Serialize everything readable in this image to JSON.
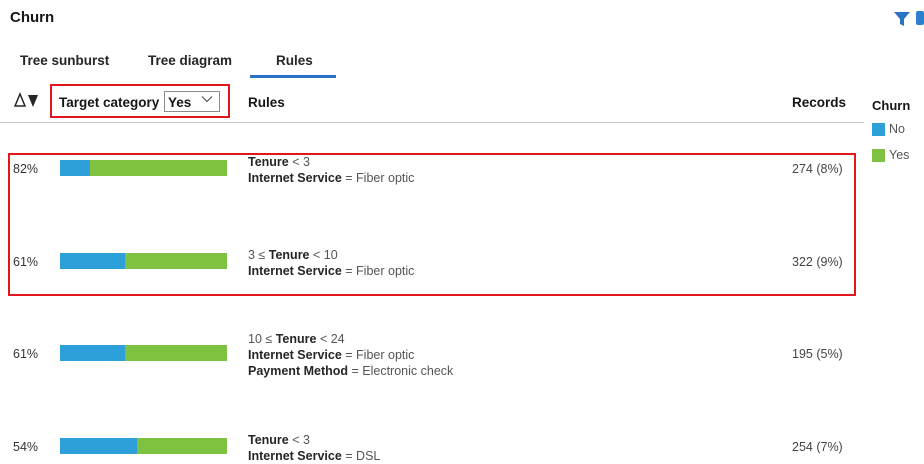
{
  "title": "Churn",
  "tabs": [
    {
      "label": "Tree sunburst",
      "active": false
    },
    {
      "label": "Tree diagram",
      "active": false
    },
    {
      "label": "Rules",
      "active": true
    }
  ],
  "header": {
    "sort_icon": "sort-triangles-icon",
    "target_label": "Target category",
    "target_value": "Yes",
    "rules_label": "Rules",
    "records_label": "Records"
  },
  "legend": {
    "title": "Churn",
    "items": [
      {
        "label": "No",
        "color": "#2d9fd9"
      },
      {
        "label": "Yes",
        "color": "#7fc241"
      }
    ]
  },
  "rows": [
    {
      "percent": "82%",
      "yes_fraction": 0.82,
      "records": "274 (8%)",
      "rule_lines": [
        {
          "pre": "",
          "field": "Tenure",
          "post": " < 3"
        },
        {
          "pre": "",
          "field": "Internet Service",
          "post": " = Fiber optic"
        }
      ]
    },
    {
      "percent": "61%",
      "yes_fraction": 0.61,
      "records": "322 (9%)",
      "rule_lines": [
        {
          "pre": "3 ≤ ",
          "field": "Tenure",
          "post": " < 10"
        },
        {
          "pre": "",
          "field": "Internet Service",
          "post": " = Fiber optic"
        }
      ]
    },
    {
      "percent": "61%",
      "yes_fraction": 0.61,
      "records": "195 (5%)",
      "rule_lines": [
        {
          "pre": "10 ≤ ",
          "field": "Tenure",
          "post": " < 24"
        },
        {
          "pre": "",
          "field": "Internet Service",
          "post": " = Fiber optic"
        },
        {
          "pre": "",
          "field": "Payment Method",
          "post": " = Electronic check"
        }
      ]
    },
    {
      "percent": "54%",
      "yes_fraction": 0.54,
      "records": "254 (7%)",
      "rule_lines": [
        {
          "pre": "",
          "field": "Tenure",
          "post": " < 3"
        },
        {
          "pre": "",
          "field": "Internet Service",
          "post": " = DSL"
        }
      ]
    }
  ],
  "colors": {
    "no": "#2d9fd9",
    "yes": "#7fc241",
    "highlight": "#e0161c",
    "accent": "#2a71c8"
  }
}
